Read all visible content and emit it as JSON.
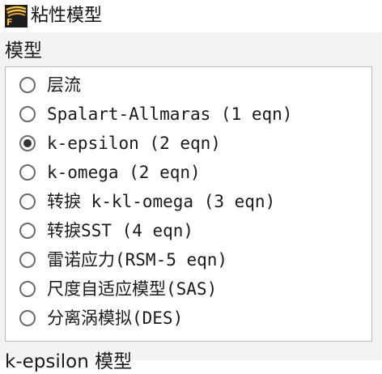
{
  "window": {
    "icon": "fluent-f-icon",
    "icon_letter": "F",
    "title": "粘性模型"
  },
  "model_group": {
    "label": "模型",
    "options": [
      {
        "label": "层流",
        "checked": false
      },
      {
        "label": "Spalart-Allmaras (1 eqn)",
        "checked": false
      },
      {
        "label": "k-epsilon (2 eqn)",
        "checked": true
      },
      {
        "label": "k-omega (2 eqn)",
        "checked": false
      },
      {
        "label": "转捩 k-kl-omega (3 eqn)",
        "checked": false
      },
      {
        "label": "转捩SST (4 eqn)",
        "checked": false
      },
      {
        "label": "雷诺应力(RSM-5 eqn)",
        "checked": false
      },
      {
        "label": "尺度自适应模型(SAS)",
        "checked": false
      },
      {
        "label": "分离涡模拟(DES)",
        "checked": false
      }
    ]
  },
  "next_section": {
    "label": "k-epsilon 模型"
  }
}
